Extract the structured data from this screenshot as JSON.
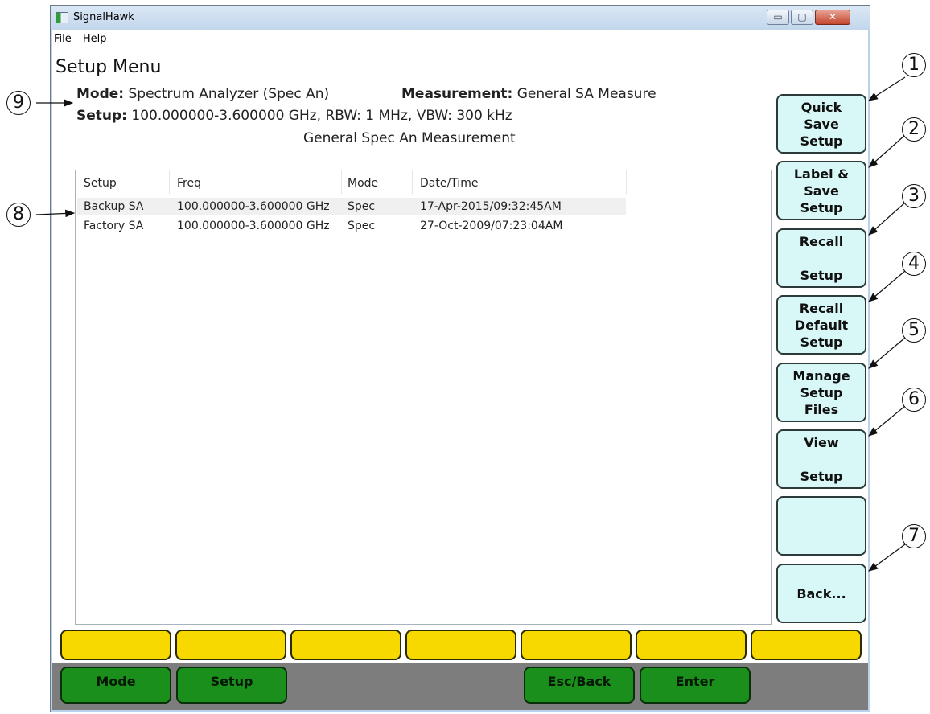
{
  "window": {
    "title": "SignalHawk",
    "controls": {
      "minimize": "▭",
      "maximize": "▢",
      "close": "✕"
    }
  },
  "menubar": {
    "items": [
      "File",
      "Help"
    ]
  },
  "page": {
    "title": "Setup Menu",
    "mode_label": "Mode:",
    "mode_value": "Spectrum Analyzer (Spec An)",
    "measurement_label": "Measurement:",
    "measurement_value": "General SA Measure",
    "setup_label": "Setup:",
    "setup_value": "100.000000-3.600000 GHz, RBW: 1 MHz, VBW: 300 kHz",
    "measurement_name": "General Spec An Measurement"
  },
  "table": {
    "columns": [
      "Setup",
      "Freq",
      "Mode",
      "Date/Time"
    ],
    "rows": [
      [
        "Backup SA",
        "100.000000-3.600000 GHz",
        "Spec",
        "17-Apr-2015/09:32:45AM"
      ],
      [
        "Factory SA",
        "100.000000-3.600000 GHz",
        "Spec",
        "27-Oct-2009/07:23:04AM"
      ]
    ]
  },
  "softkeys": [
    [
      "Quick",
      "Save",
      "Setup"
    ],
    [
      "Label &",
      "Save",
      "Setup"
    ],
    [
      "Recall",
      "",
      "Setup"
    ],
    [
      "Recall",
      "Default",
      "Setup"
    ],
    [
      "Manage",
      "Setup",
      "Files"
    ],
    [
      "View",
      "",
      "Setup"
    ],
    [],
    [
      "Back..."
    ]
  ],
  "bottom_buttons": [
    "Mode",
    "Setup",
    "Esc/Back",
    "Enter"
  ],
  "callouts": [
    "1",
    "2",
    "3",
    "4",
    "5",
    "6",
    "7",
    "8",
    "9"
  ],
  "colors": {
    "softkey_bg": "#d8f7f7",
    "yellow_key": "#f7d900",
    "green_key": "#1b8f1b",
    "bottom_bar": "#7d7d7d"
  }
}
